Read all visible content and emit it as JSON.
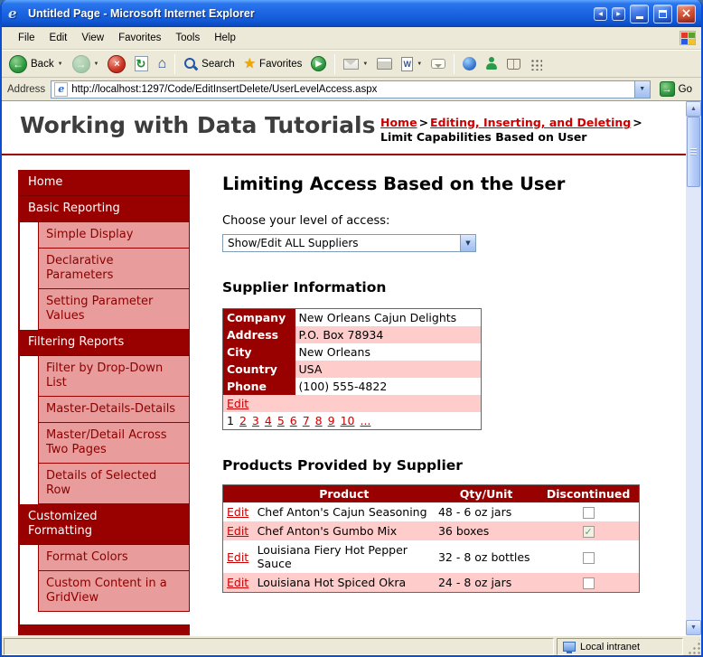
{
  "window": {
    "title": "Untitled Page - Microsoft Internet Explorer",
    "menu": [
      "File",
      "Edit",
      "View",
      "Favorites",
      "Tools",
      "Help"
    ],
    "toolbar": {
      "back_label": "Back",
      "search_label": "Search",
      "favorites_label": "Favorites"
    },
    "address": {
      "label": "Address",
      "url": "http://localhost:1297/Code/EditInsertDelete/UserLevelAccess.aspx",
      "go_label": "Go"
    },
    "status": {
      "zone": "Local intranet"
    }
  },
  "page": {
    "site_title": "Working with Data Tutorials",
    "breadcrumb": {
      "home": "Home",
      "section": "Editing, Inserting, and Deleting",
      "current": "Limit Capabilities Based on User",
      "separator": ">"
    },
    "sidebar": {
      "items": [
        {
          "label": "Home",
          "type": "header"
        },
        {
          "label": "Basic Reporting",
          "type": "header"
        },
        {
          "label": "Simple Display",
          "type": "item"
        },
        {
          "label": "Declarative Parameters",
          "type": "item"
        },
        {
          "label": "Setting Parameter Values",
          "type": "item"
        },
        {
          "label": "Filtering Reports",
          "type": "header"
        },
        {
          "label": "Filter by Drop-Down List",
          "type": "item"
        },
        {
          "label": "Master-Details-Details",
          "type": "item"
        },
        {
          "label": "Master/Detail Across Two Pages",
          "type": "item"
        },
        {
          "label": "Details of Selected Row",
          "type": "item"
        },
        {
          "label": "Customized Formatting",
          "type": "header"
        },
        {
          "label": "Format Colors",
          "type": "item"
        },
        {
          "label": "Custom Content in a GridView",
          "type": "item"
        }
      ]
    },
    "main": {
      "title": "Limiting Access Based on the User",
      "access_label": "Choose your level of access:",
      "access_value": "Show/Edit ALL Suppliers",
      "supplier_heading": "Supplier Information",
      "supplier_fields": [
        {
          "label": "Company",
          "value": "New Orleans Cajun Delights"
        },
        {
          "label": "Address",
          "value": "P.O. Box 78934"
        },
        {
          "label": "City",
          "value": "New Orleans"
        },
        {
          "label": "Country",
          "value": "USA"
        },
        {
          "label": "Phone",
          "value": "(100) 555-4822"
        }
      ],
      "edit_label": "Edit",
      "pager": {
        "current": "1",
        "pages": [
          "1",
          "2",
          "3",
          "4",
          "5",
          "6",
          "7",
          "8",
          "9",
          "10",
          "..."
        ]
      },
      "products_heading": "Products Provided by Supplier",
      "products": {
        "headers": [
          "",
          "Product",
          "Qty/Unit",
          "Discontinued"
        ],
        "rows": [
          {
            "product": "Chef Anton's Cajun Seasoning",
            "qty": "48 - 6 oz jars",
            "discontinued": false
          },
          {
            "product": "Chef Anton's Gumbo Mix",
            "qty": "36 boxes",
            "discontinued": true
          },
          {
            "product": "Louisiana Fiery Hot Pepper Sauce",
            "qty": "32 - 8 oz bottles",
            "discontinued": false
          },
          {
            "product": "Louisiana Hot Spiced Okra",
            "qty": "24 - 8 oz jars",
            "discontinued": false
          }
        ]
      }
    }
  },
  "colors": {
    "accent_dark_red": "#990000",
    "row_pink": "#ffcccc",
    "sidebar_pink": "#e89c9c",
    "link_red": "#cc0000",
    "chrome_tan": "#ece9d8"
  }
}
